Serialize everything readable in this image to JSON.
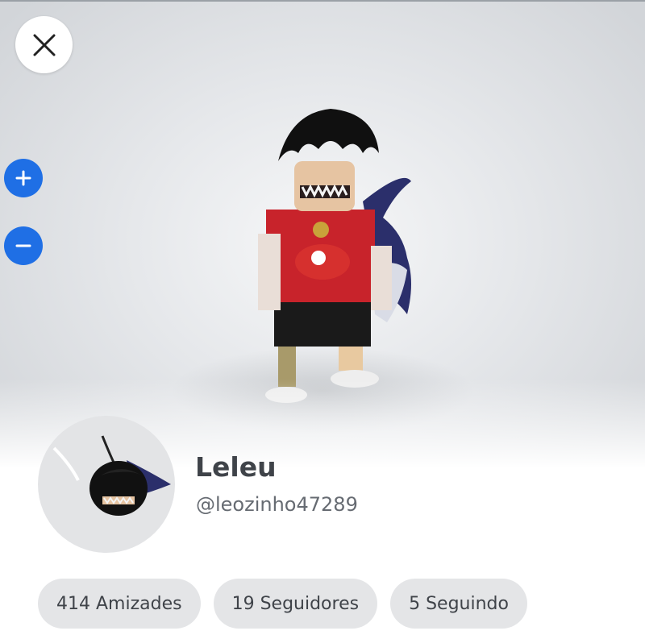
{
  "profile": {
    "display_name": "Leleu",
    "username": "@leozinho47289"
  },
  "stats": {
    "friends": "414 Amizades",
    "followers": "19 Seguidores",
    "following": "5 Seguindo"
  },
  "controls": {
    "close_icon": "close-icon",
    "zoom_in_icon": "plus-icon",
    "zoom_out_icon": "minus-icon"
  },
  "colors": {
    "zoom_button": "#1f6fe5",
    "pill_background": "#e4e5e7",
    "text_primary": "#3f4349",
    "text_secondary": "#666b72"
  }
}
